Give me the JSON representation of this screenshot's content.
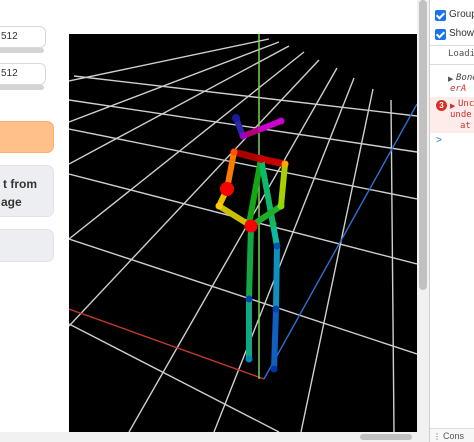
{
  "controls": {
    "input_1": {
      "value": "512"
    },
    "input_2": {
      "value": "512"
    },
    "button_from_image": {
      "line1": "t from",
      "line2": "age"
    }
  },
  "devtools": {
    "checkbox_group": {
      "label": "Group",
      "checked": true
    },
    "checkbox_show": {
      "label": "Show",
      "checked": true
    },
    "log_loading": "Loadi",
    "warning_line1": "Bone",
    "warning_line2": "erA",
    "error_count": "3",
    "error_line1": "Unc",
    "error_line2": "unde",
    "error_line3": "at",
    "prompt": ">",
    "bottom_tab": "Cons"
  },
  "colors": {
    "accent_orange": "#ffc08a",
    "viewport_bg": "#000000",
    "grid": "#cfcfcf",
    "axis_x": "#c0392b",
    "axis_y": "#7fe05a",
    "axis_z": "#2f6fd0",
    "error_red": "#d32f2f"
  }
}
